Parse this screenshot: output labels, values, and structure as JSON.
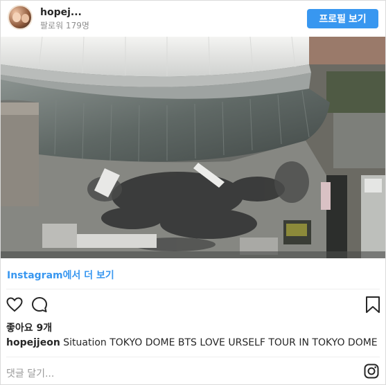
{
  "header": {
    "username": "hopej...",
    "followers": "팔로워 179명",
    "profile_button": "프로필 보기"
  },
  "post": {
    "view_more": "Instagram에서 더 보기",
    "likes": "좋아요 9개",
    "caption_user": "hopejjeon",
    "caption_text": " Situation TOKYO DOME BTS LOVE URSELF TOUR IN TOKYO DOME",
    "comment_placeholder": "댓글 달기..."
  },
  "icons": {
    "like": "heart-icon",
    "comment": "comment-icon",
    "save": "bookmark-icon",
    "brand": "instagram-icon"
  },
  "colors": {
    "accent": "#3897f0",
    "text": "#262626",
    "muted": "#8e8e8e"
  }
}
